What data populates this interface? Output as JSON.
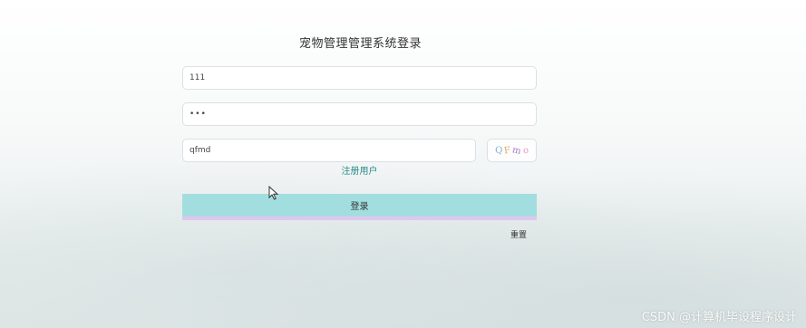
{
  "page": {
    "title": "宠物管理管理系统登录"
  },
  "form": {
    "username_value": "111",
    "password_value": "•••",
    "captcha_value": "qfmd",
    "captcha_image_chars": [
      "Q",
      "F",
      "m",
      "o"
    ],
    "captcha_colors": [
      "#7fb0d8",
      "#e3a85c",
      "#a57cc9",
      "#e39ab5"
    ],
    "register_link": "注册用户",
    "login_label": "登录",
    "reset_label": "重置"
  },
  "colors": {
    "login_button_bg": "#a2dedf",
    "login_button_border": "#e0c6ee",
    "register_link": "#2d8a8a"
  },
  "watermark": "CSDN @计算机毕设程序设计"
}
